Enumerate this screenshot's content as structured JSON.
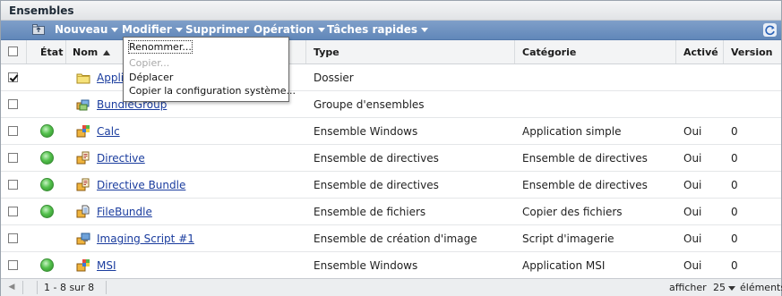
{
  "panel": {
    "title": "Ensembles"
  },
  "toolbar": {
    "menus": [
      {
        "label": "Nouveau"
      },
      {
        "label": "Modifier"
      },
      {
        "label": "Supprimer"
      },
      {
        "label": "Opération"
      },
      {
        "label": "Tâches rapides"
      }
    ]
  },
  "columns": {
    "etat": "État",
    "nom": "Nom",
    "type": "Type",
    "categorie": "Catégorie",
    "active": "Activé",
    "version": "Version"
  },
  "dropdown": {
    "items": [
      {
        "label": "Renommer...",
        "enabled": true
      },
      {
        "label": "Copier...",
        "enabled": false
      },
      {
        "label": "Déplacer",
        "enabled": true
      },
      {
        "label": "Copier la configuration système...",
        "enabled": true
      }
    ]
  },
  "rows": [
    {
      "checked": true,
      "status": "",
      "icon": "folder-icon",
      "name": "Appli",
      "type": "Dossier",
      "categorie": "",
      "active": "",
      "version": ""
    },
    {
      "checked": false,
      "status": "",
      "icon": "bundle-group-icon",
      "name": "BundleGroup",
      "type": "Groupe d'ensembles",
      "categorie": "",
      "active": "",
      "version": ""
    },
    {
      "checked": false,
      "status": "green",
      "icon": "windows-bundle-icon",
      "name": "Calc",
      "type": "Ensemble Windows",
      "categorie": "Application simple",
      "active": "Oui",
      "version": "0"
    },
    {
      "checked": false,
      "status": "green",
      "icon": "policy-bundle-icon",
      "name": "Directive",
      "type": "Ensemble de directives",
      "categorie": "Ensemble de directives",
      "active": "Oui",
      "version": "0"
    },
    {
      "checked": false,
      "status": "green",
      "icon": "policy-bundle-icon",
      "name": "Directive Bundle",
      "type": "Ensemble de directives",
      "categorie": "Ensemble de directives",
      "active": "Oui",
      "version": "0"
    },
    {
      "checked": false,
      "status": "green",
      "icon": "file-bundle-icon",
      "name": "FileBundle",
      "type": "Ensemble de fichiers",
      "categorie": "Copier des fichiers",
      "active": "Oui",
      "version": "0"
    },
    {
      "checked": false,
      "status": "",
      "icon": "imaging-bundle-icon",
      "name": "Imaging Script #1",
      "type": "Ensemble de création d'image",
      "categorie": "Script d'imagerie",
      "active": "Oui",
      "version": "0"
    },
    {
      "checked": false,
      "status": "green",
      "icon": "windows-bundle-icon",
      "name": "MSI",
      "type": "Ensemble Windows",
      "categorie": "Application MSI",
      "active": "Oui",
      "version": "0"
    }
  ],
  "footer": {
    "range": "1 - 8 sur 8",
    "show_label": "afficher",
    "page_size": "25",
    "items_label": "éléments"
  }
}
